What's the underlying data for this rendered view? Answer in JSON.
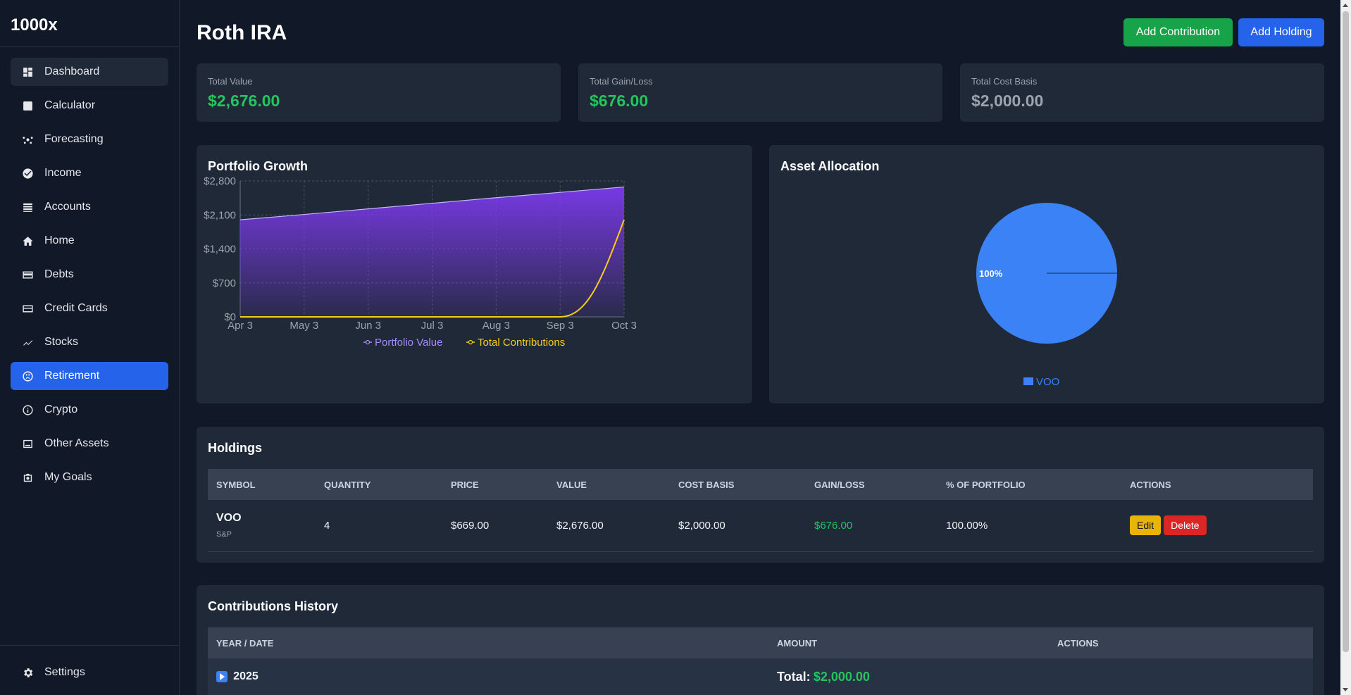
{
  "app": {
    "brand": "1000x"
  },
  "sidebar": {
    "items": [
      {
        "label": "Dashboard",
        "icon": "dashboard-icon"
      },
      {
        "label": "Calculator",
        "icon": "calculator-icon"
      },
      {
        "label": "Forecasting",
        "icon": "forecasting-icon"
      },
      {
        "label": "Income",
        "icon": "income-icon"
      },
      {
        "label": "Accounts",
        "icon": "accounts-icon"
      },
      {
        "label": "Home",
        "icon": "home-icon"
      },
      {
        "label": "Debts",
        "icon": "debts-icon"
      },
      {
        "label": "Credit Cards",
        "icon": "credit-card-icon"
      },
      {
        "label": "Stocks",
        "icon": "stocks-icon"
      },
      {
        "label": "Retirement",
        "icon": "retirement-icon"
      },
      {
        "label": "Crypto",
        "icon": "crypto-icon"
      },
      {
        "label": "Other Assets",
        "icon": "other-assets-icon"
      },
      {
        "label": "My Goals",
        "icon": "goals-icon"
      }
    ],
    "settings_label": "Settings",
    "active": "Retirement"
  },
  "header": {
    "title": "Roth IRA",
    "add_contribution_label": "Add Contribution",
    "add_holding_label": "Add Holding"
  },
  "stats": [
    {
      "label": "Total Value",
      "value": "$2,676.00"
    },
    {
      "label": "Total Gain/Loss",
      "value": "$676.00"
    },
    {
      "label": "Total Cost Basis",
      "value": "$2,000.00"
    }
  ],
  "portfolio_growth": {
    "title": "Portfolio Growth"
  },
  "asset_allocation": {
    "title": "Asset Allocation",
    "slice_label": "100%",
    "legend": "VOO"
  },
  "chart_data": [
    {
      "type": "area",
      "title": "Portfolio Growth",
      "x": [
        "Apr 3",
        "May 3",
        "Jun 3",
        "Jul 3",
        "Aug 3",
        "Sep 3",
        "Oct 3"
      ],
      "y_ticks": [
        "$0",
        "$700",
        "$1,400",
        "$2,100",
        "$2,800"
      ],
      "ylim": [
        0,
        2800
      ],
      "grid": true,
      "legend_position": "bottom",
      "series": [
        {
          "name": "Portfolio Value",
          "color": "#8b5cf6",
          "values": [
            2000,
            2110,
            2225,
            2340,
            2455,
            2565,
            2676
          ]
        },
        {
          "name": "Total Contributions",
          "color": "#facc15",
          "values": [
            0,
            0,
            0,
            0,
            0,
            0,
            2000
          ]
        }
      ]
    },
    {
      "type": "pie",
      "title": "Asset Allocation",
      "labels": [
        "VOO"
      ],
      "values": [
        100
      ],
      "colors": [
        "#3b82f6"
      ],
      "legend_position": "bottom"
    }
  ],
  "holdings": {
    "title": "Holdings",
    "columns": [
      "SYMBOL",
      "QUANTITY",
      "PRICE",
      "VALUE",
      "COST BASIS",
      "GAIN/LOSS",
      "% OF PORTFOLIO",
      "ACTIONS"
    ],
    "rows": [
      {
        "symbol": "VOO",
        "name": "S&P",
        "quantity": "4",
        "price": "$669.00",
        "value": "$2,676.00",
        "cost_basis": "$2,000.00",
        "gain_loss": "$676.00",
        "pct": "100.00%",
        "edit_label": "Edit",
        "delete_label": "Delete"
      }
    ]
  },
  "contributions": {
    "title": "Contributions History",
    "columns": [
      "YEAR / DATE",
      "AMOUNT",
      "ACTIONS"
    ],
    "rows": [
      {
        "year": "2025",
        "total_label": "Total:",
        "total_value": "$2,000.00"
      }
    ]
  }
}
